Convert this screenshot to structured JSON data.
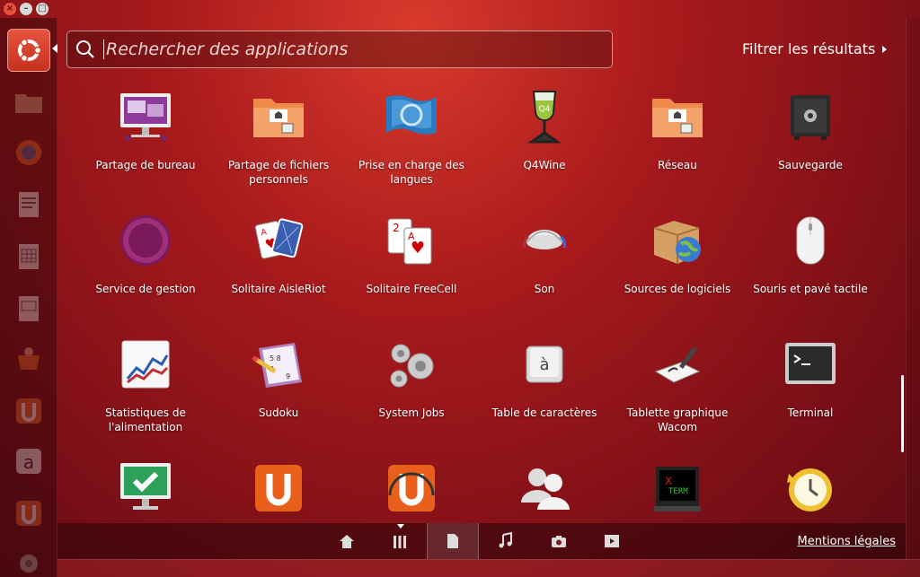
{
  "search": {
    "placeholder": "Rechercher des applications",
    "value": ""
  },
  "filter": {
    "label": "Filtrer les résultats"
  },
  "apps": [
    {
      "label": "Partage de bureau",
      "icon": "desktop-sharing-icon"
    },
    {
      "label": "Partage de fichiers personnels",
      "icon": "folder-share-icon"
    },
    {
      "label": "Prise en charge des langues",
      "icon": "language-flag-icon"
    },
    {
      "label": "Q4Wine",
      "icon": "wine-glass-icon"
    },
    {
      "label": "Réseau",
      "icon": "network-folder-icon"
    },
    {
      "label": "Sauvegarde",
      "icon": "safe-icon"
    },
    {
      "label": "Service de gestion",
      "icon": "management-ring-icon"
    },
    {
      "label": "Solitaire AisleRiot",
      "icon": "playing-cards-icon"
    },
    {
      "label": "Solitaire FreeCell",
      "icon": "freecell-cards-icon"
    },
    {
      "label": "Son",
      "icon": "sound-icon"
    },
    {
      "label": "Sources de logiciels",
      "icon": "software-sources-icon"
    },
    {
      "label": "Souris et pavé tactile",
      "icon": "mouse-icon"
    },
    {
      "label": "Statistiques de l'alimentation",
      "icon": "power-statistics-icon"
    },
    {
      "label": "Sudoku",
      "icon": "sudoku-icon"
    },
    {
      "label": "System Jobs",
      "icon": "gears-icon"
    },
    {
      "label": "Table de caractères",
      "icon": "character-map-icon"
    },
    {
      "label": "Tablette graphique Wacom",
      "icon": "wacom-tablet-icon"
    },
    {
      "label": "Terminal",
      "icon": "terminal-icon"
    },
    {
      "label": "",
      "icon": "checkmark-monitor-icon"
    },
    {
      "label": "",
      "icon": "ubuntu-one-icon"
    },
    {
      "label": "",
      "icon": "ubuntu-one-music-icon"
    },
    {
      "label": "",
      "icon": "users-icon"
    },
    {
      "label": "",
      "icon": "xterm-icon"
    },
    {
      "label": "",
      "icon": "restore-clock-icon"
    }
  ],
  "launcher": [
    "ubuntu-home-icon",
    "files-icon",
    "firefox-icon",
    "writer-icon",
    "calc-icon",
    "impress-icon",
    "software-center-icon",
    "ubuntu-one-icon",
    "amazon-icon",
    "ubuntu-one-music-icon",
    "settings-icon"
  ],
  "lenses": [
    "home-lens-icon",
    "applications-lens-icon",
    "files-lens-icon",
    "music-lens-icon",
    "photos-lens-icon",
    "video-lens-icon"
  ],
  "legal": {
    "label": "Mentions légales"
  },
  "colors": {
    "accent": "#dd4814",
    "background": "#a81a1c"
  }
}
